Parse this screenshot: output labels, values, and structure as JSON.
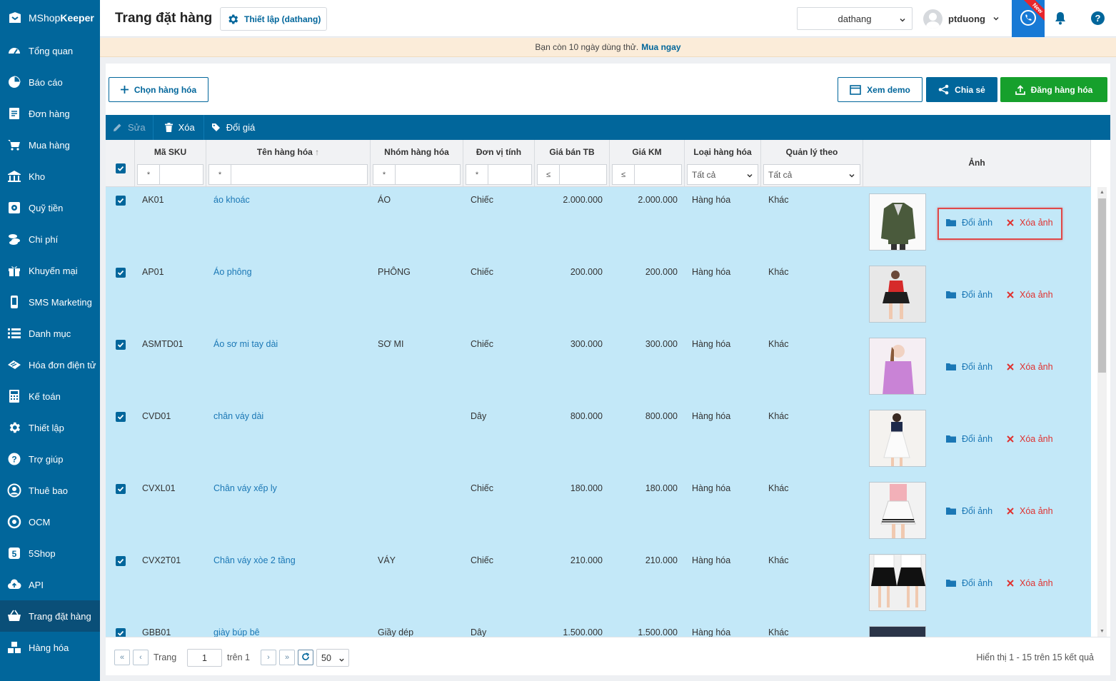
{
  "brand": {
    "prefix": "MShop",
    "suffix": "Keeper"
  },
  "sidebar": {
    "items": [
      {
        "label": "Tổng quan",
        "icon": "dashboard-icon"
      },
      {
        "label": "Báo cáo",
        "icon": "pie-chart-icon"
      },
      {
        "label": "Đơn hàng",
        "icon": "orders-icon"
      },
      {
        "label": "Mua hàng",
        "icon": "cart-icon"
      },
      {
        "label": "Kho",
        "icon": "warehouse-icon"
      },
      {
        "label": "Quỹ tiền",
        "icon": "safe-icon"
      },
      {
        "label": "Chi phí",
        "icon": "coins-icon"
      },
      {
        "label": "Khuyến mại",
        "icon": "gift-icon"
      },
      {
        "label": "SMS Marketing",
        "icon": "phone-icon"
      },
      {
        "label": "Danh mục",
        "icon": "list-icon"
      },
      {
        "label": "Hóa đơn điện tử",
        "icon": "invoice-icon"
      },
      {
        "label": "Kế toán",
        "icon": "calculator-icon"
      },
      {
        "label": "Thiết lập",
        "icon": "gear-icon"
      },
      {
        "label": "Trợ giúp",
        "icon": "help-icon"
      },
      {
        "label": "Thuê bao",
        "icon": "user-circle-icon"
      },
      {
        "label": "OCM",
        "icon": "ocm-icon"
      },
      {
        "label": "5Shop",
        "icon": "5shop-icon"
      },
      {
        "label": "API",
        "icon": "cloud-upload-icon"
      },
      {
        "label": "Trang đặt hàng",
        "icon": "shopping-basket-icon",
        "active": true
      },
      {
        "label": "Hàng hóa",
        "icon": "boxes-icon"
      }
    ]
  },
  "header": {
    "title": "Trang đặt hàng",
    "setup_label": "Thiết lập (dathang)",
    "store": "dathang",
    "user": "ptduong",
    "new_badge": "New"
  },
  "trial": {
    "text": "Bạn còn 10 ngày dùng thử.",
    "link": "Mua ngay"
  },
  "actions": {
    "choose": "Chọn hàng hóa",
    "demo": "Xem demo",
    "share": "Chia sẻ",
    "publish": "Đăng hàng hóa"
  },
  "toolbar": {
    "edit": "Sửa",
    "delete": "Xóa",
    "price": "Đổi giá"
  },
  "columns": {
    "sku": "Mã SKU",
    "name": "Tên hàng hóa",
    "group": "Nhóm hàng hóa",
    "unit": "Đơn vị tính",
    "price": "Giá bán TB",
    "promo": "Giá KM",
    "type": "Loại hàng hóa",
    "manage": "Quản lý theo",
    "image": "Ảnh"
  },
  "filters": {
    "star": "*",
    "lte": "≤",
    "all": "Tất cả"
  },
  "row_actions": {
    "change": "Đổi ảnh",
    "remove": "Xóa ảnh"
  },
  "rows": [
    {
      "sku": "AK01",
      "name": "áo khoác",
      "group": "ÁO",
      "unit": "Chiếc",
      "price": "2.000.000",
      "promo": "2.000.000",
      "type": "Hàng hóa",
      "manage": "Khác",
      "thumb": "jacket"
    },
    {
      "sku": "AP01",
      "name": "Áo phông",
      "group": "PHÔNG",
      "unit": "Chiếc",
      "price": "200.000",
      "promo": "200.000",
      "type": "Hàng hóa",
      "manage": "Khác",
      "thumb": "tshirt"
    },
    {
      "sku": "ASMTD01",
      "name": "Áo sơ mi tay dài",
      "group": "SƠ MI",
      "unit": "Chiếc",
      "price": "300.000",
      "promo": "300.000",
      "type": "Hàng hóa",
      "manage": "Khác",
      "thumb": "shirt"
    },
    {
      "sku": "CVD01",
      "name": "chân váy dài",
      "group": "",
      "unit": "Dây",
      "price": "800.000",
      "promo": "800.000",
      "type": "Hàng hóa",
      "manage": "Khác",
      "thumb": "longskirt"
    },
    {
      "sku": "CVXL01",
      "name": "Chân váy xếp ly",
      "group": "",
      "unit": "Chiếc",
      "price": "180.000",
      "promo": "180.000",
      "type": "Hàng hóa",
      "manage": "Khác",
      "thumb": "pleated"
    },
    {
      "sku": "CVX2T01",
      "name": "Chân váy xòe 2 tầng",
      "group": "VÁY",
      "unit": "Chiếc",
      "price": "210.000",
      "promo": "210.000",
      "type": "Hàng hóa",
      "manage": "Khác",
      "thumb": "tiered"
    },
    {
      "sku": "GBB01",
      "name": "giày búp bê",
      "group": "Giầy dép",
      "unit": "Dây",
      "price": "1.500.000",
      "promo": "1.500.000",
      "type": "Hàng hóa",
      "manage": "Khác",
      "thumb": "shoes"
    }
  ],
  "pager": {
    "page_label": "Trang",
    "page": "1",
    "of_label": "trên 1",
    "page_size": "50",
    "summary": "Hiển thị 1 - 15 trên 15 kết quả"
  }
}
